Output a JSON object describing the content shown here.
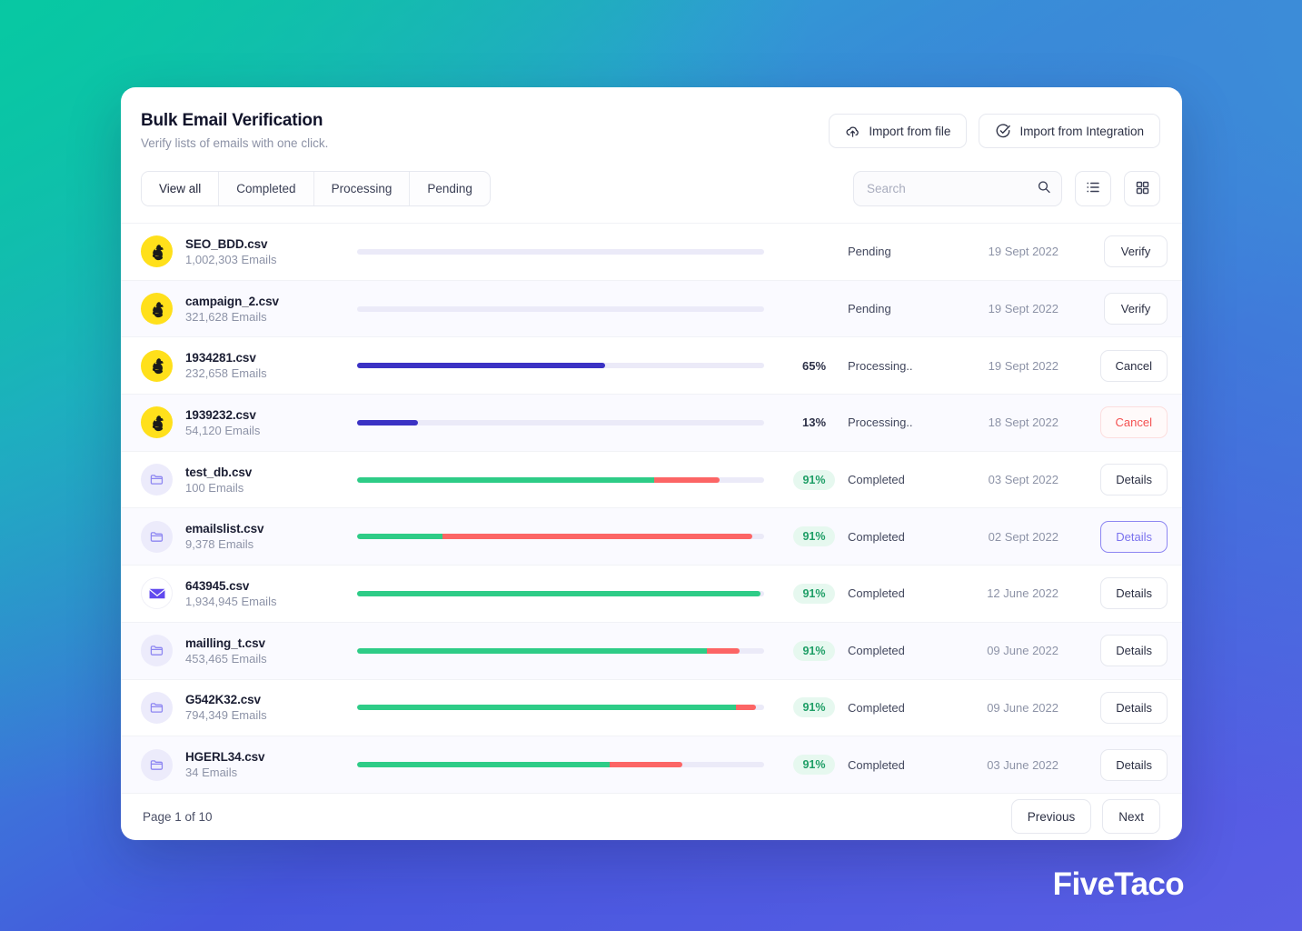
{
  "header": {
    "title": "Bulk Email Verification",
    "subtitle": "Verify lists of emails with one click.",
    "import_file_label": "Import from file",
    "import_integration_label": "Import from Integration"
  },
  "tabs": [
    {
      "label": "View all",
      "active": true
    },
    {
      "label": "Completed",
      "active": false
    },
    {
      "label": "Processing",
      "active": false
    },
    {
      "label": "Pending",
      "active": false
    }
  ],
  "search": {
    "value": "",
    "placeholder": "Search"
  },
  "view_toggle": {
    "list_label": "list-view",
    "grid_label": "grid-view"
  },
  "colors": {
    "progress_blue": "#3b32c4",
    "progress_green": "#2ecc87",
    "progress_red": "#fc6565",
    "track": "#ebeaf8",
    "badge_text": "#1e9e66",
    "badge_bg": "#e6f8ef",
    "danger": "#f45252",
    "accent": "#7a72ee",
    "mailchimp_yellow": "#FFE01B"
  },
  "rows": [
    {
      "filename": "SEO_BDD.csv",
      "emails": "1,002,303 Emails",
      "icon": "mailchimp-icon",
      "avatar": "mailchimp",
      "percent": "",
      "status": "Pending",
      "date": "19 Sept 2022",
      "action": "Verify",
      "action_style": "default",
      "bar": {
        "green": 0,
        "red": 0,
        "blue": 0
      }
    },
    {
      "filename": "campaign_2.csv",
      "emails": "321,628 Emails",
      "icon": "mailchimp-icon",
      "avatar": "mailchimp",
      "percent": "",
      "status": "Pending",
      "date": "19 Sept 2022",
      "action": "Verify",
      "action_style": "default",
      "bar": {
        "green": 0,
        "red": 0,
        "blue": 0
      }
    },
    {
      "filename": "1934281.csv",
      "emails": "232,658 Emails",
      "icon": "mailchimp-icon",
      "avatar": "mailchimp",
      "percent": "65%",
      "status": "Processing..",
      "date": "19 Sept 2022",
      "action": "Cancel",
      "action_style": "default",
      "bar": {
        "green": 0,
        "red": 0,
        "blue": 61
      }
    },
    {
      "filename": "1939232.csv",
      "emails": "54,120 Emails",
      "icon": "mailchimp-icon",
      "avatar": "mailchimp",
      "percent": "13%",
      "status": "Processing..",
      "date": "18 Sept 2022",
      "action": "Cancel",
      "action_style": "danger",
      "bar": {
        "green": 0,
        "red": 0,
        "blue": 15
      }
    },
    {
      "filename": "test_db.csv",
      "emails": "100 Emails",
      "icon": "folder-icon",
      "avatar": "folder",
      "percent": "91%",
      "status": "Completed",
      "date": "03 Sept 2022",
      "action": "Details",
      "action_style": "default",
      "bar": {
        "green": 73,
        "red": 16,
        "blue": 0
      }
    },
    {
      "filename": "emailslist.csv",
      "emails": "9,378 Emails",
      "icon": "folder-icon",
      "avatar": "folder",
      "percent": "91%",
      "status": "Completed",
      "date": "02 Sept 2022",
      "action": "Details",
      "action_style": "accent",
      "bar": {
        "green": 21,
        "red": 76,
        "blue": 0
      }
    },
    {
      "filename": "643945.csv",
      "emails": "1,934,945 Emails",
      "icon": "envelope-icon",
      "avatar": "mailjet",
      "percent": "91%",
      "status": "Completed",
      "date": "12 June 2022",
      "action": "Details",
      "action_style": "default",
      "bar": {
        "green": 99,
        "red": 0,
        "blue": 0
      }
    },
    {
      "filename": "mailling_t.csv",
      "emails": "453,465 Emails",
      "icon": "folder-icon",
      "avatar": "folder",
      "percent": "91%",
      "status": "Completed",
      "date": "09 June 2022",
      "action": "Details",
      "action_style": "default",
      "bar": {
        "green": 86,
        "red": 8,
        "blue": 0
      }
    },
    {
      "filename": "G542K32.csv",
      "emails": "794,349 Emails",
      "icon": "folder-icon",
      "avatar": "folder",
      "percent": "91%",
      "status": "Completed",
      "date": "09 June 2022",
      "action": "Details",
      "action_style": "default",
      "bar": {
        "green": 93,
        "red": 5,
        "blue": 0
      }
    },
    {
      "filename": "HGERL34.csv",
      "emails": "34 Emails",
      "icon": "folder-icon",
      "avatar": "folder",
      "percent": "91%",
      "status": "Completed",
      "date": "03 June 2022",
      "action": "Details",
      "action_style": "default",
      "bar": {
        "green": 62,
        "red": 18,
        "blue": 0
      }
    }
  ],
  "footer": {
    "page_label": "Page 1 of 10",
    "previous_label": "Previous",
    "next_label": "Next"
  },
  "brand": "FiveTaco"
}
